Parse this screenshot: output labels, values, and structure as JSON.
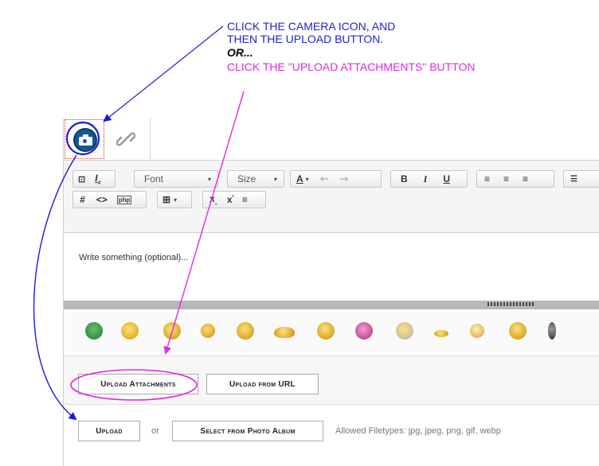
{
  "annotations": {
    "line1": "CLICK THE CAMERA ICON, AND",
    "line2": "THEN THE UPLOAD BUTTON.",
    "line3": "OR...",
    "line4": "CLICK THE \"UPLOAD ATTACHMENTS\" BUTTON"
  },
  "toolbar": {
    "font_label": "Font",
    "size_label": "Size"
  },
  "editor": {
    "placeholder": "Write something (optional)..."
  },
  "upload_tabs": {
    "upload_attachments": "Upload Attachments",
    "upload_from_url": "Upload from URL"
  },
  "upload_row": {
    "upload_label": "Upload",
    "or_text": "or",
    "select_album_label": "Select from Photo Album",
    "allowed_filetypes": "Allowed Filetypes: jpg, jpeg, png, gif, webp"
  },
  "colors": {
    "annotation_blue": "#2222d0",
    "annotation_pink": "#e02be0",
    "camera_blue": "#16588f"
  }
}
